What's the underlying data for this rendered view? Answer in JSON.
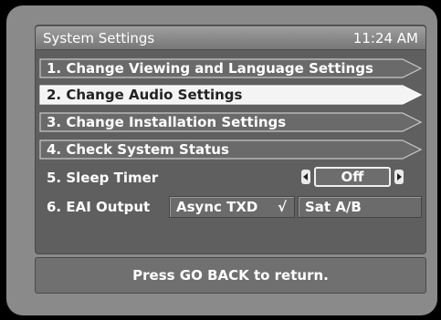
{
  "header": {
    "title": "System Settings",
    "clock": "11:24 AM"
  },
  "menu": {
    "items": [
      {
        "label": "1.  Change Viewing and Language Settings",
        "selected": false
      },
      {
        "label": "2.  Change Audio Settings",
        "selected": true
      },
      {
        "label": "3.  Change Installation Settings",
        "selected": false
      },
      {
        "label": "4.  Check System Status",
        "selected": false
      }
    ]
  },
  "sleep_timer": {
    "label": "5.  Sleep Timer",
    "value": "Off"
  },
  "eai_output": {
    "label": "6.  EAI Output",
    "options": [
      {
        "label": "Async TXD",
        "checked": true,
        "check_glyph": "√"
      },
      {
        "label": "Sat A/B",
        "checked": false
      }
    ]
  },
  "footer": {
    "hint": "Press GO BACK to return."
  },
  "colors": {
    "panel": "#5f5f5f",
    "menu_bar": "#6a6a6a",
    "selected_bar": "#f4f4f4",
    "background": "#000000"
  },
  "icons": {
    "left_arrow": "chevron-left-icon",
    "right_arrow": "chevron-right-icon",
    "check": "check-icon"
  }
}
